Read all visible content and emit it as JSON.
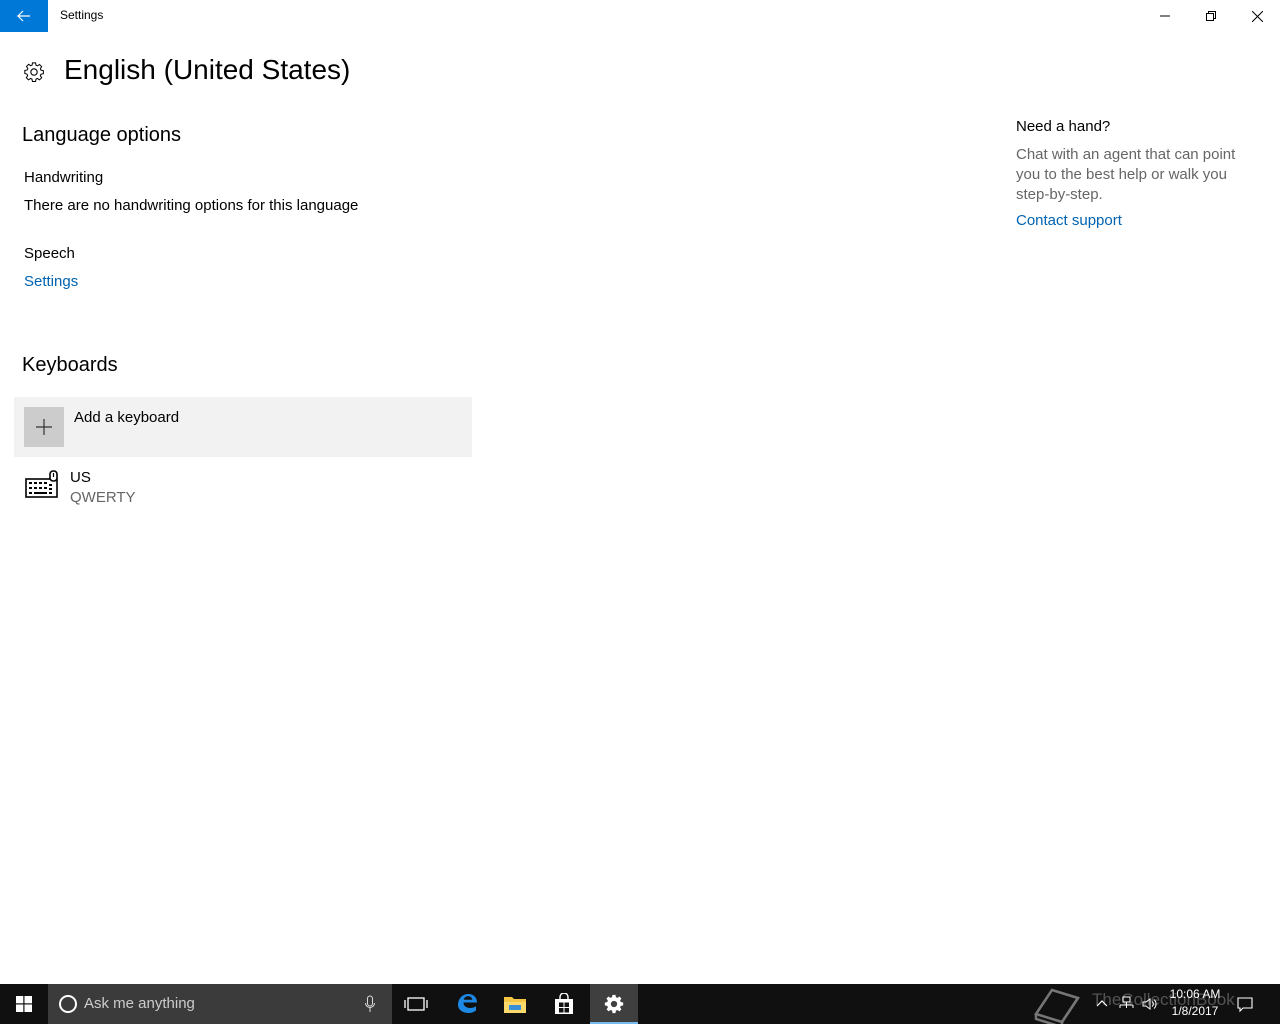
{
  "window": {
    "title": "Settings"
  },
  "page": {
    "title": "English (United States)"
  },
  "language_options": {
    "heading": "Language options",
    "handwriting_label": "Handwriting",
    "handwriting_text": "There are no handwriting options for this language",
    "speech_label": "Speech",
    "speech_link": "Settings"
  },
  "keyboards": {
    "heading": "Keyboards",
    "add_label": "Add a keyboard",
    "items": [
      {
        "name": "US",
        "layout": "QWERTY"
      }
    ]
  },
  "help": {
    "title": "Need a hand?",
    "text": "Chat with an agent that can point you to the best help or walk you step-by-step.",
    "link": "Contact support"
  },
  "taskbar": {
    "search_placeholder": "Ask me anything",
    "time": "10:06 AM",
    "date": "1/8/2017",
    "watermark": "TheCollectionBook"
  },
  "colors": {
    "accent": "#0078d7",
    "link": "#0063b1",
    "taskbar": "#101010"
  }
}
